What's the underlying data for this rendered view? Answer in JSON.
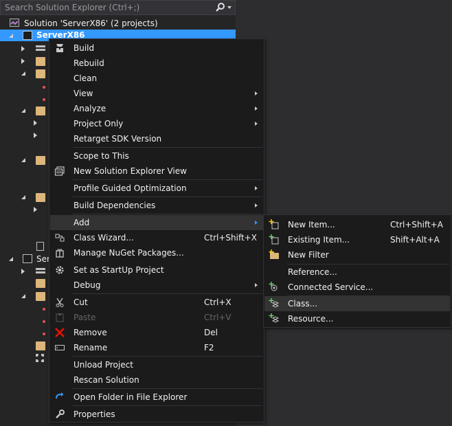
{
  "search": {
    "placeholder": "Search Solution Explorer (Ctrl+;)"
  },
  "tree": {
    "solution_label": "Solution 'ServerX86' (2 projects)",
    "project1_label": "ServerX86",
    "project2_label": "Ser"
  },
  "context_menu": {
    "build": "Build",
    "rebuild": "Rebuild",
    "clean": "Clean",
    "view": "View",
    "analyze": "Analyze",
    "project_only": "Project Only",
    "retarget": "Retarget SDK Version",
    "scope": "Scope to This",
    "new_view": "New Solution Explorer View",
    "pgo": "Profile Guided Optimization",
    "build_deps": "Build Dependencies",
    "add": "Add",
    "class_wizard": "Class Wizard...",
    "class_wizard_shortcut": "Ctrl+Shift+X",
    "nuget": "Manage NuGet Packages...",
    "startup": "Set as StartUp Project",
    "debug": "Debug",
    "cut": "Cut",
    "cut_shortcut": "Ctrl+X",
    "paste": "Paste",
    "paste_shortcut": "Ctrl+V",
    "remove": "Remove",
    "remove_shortcut": "Del",
    "rename": "Rename",
    "rename_shortcut": "F2",
    "unload": "Unload Project",
    "rescan": "Rescan Solution",
    "open_folder": "Open Folder in File Explorer",
    "properties": "Properties"
  },
  "add_submenu": {
    "new_item": "New Item...",
    "new_item_shortcut": "Ctrl+Shift+A",
    "existing_item": "Existing Item...",
    "existing_item_shortcut": "Shift+Alt+A",
    "new_filter": "New Filter",
    "reference": "Reference...",
    "connected_service": "Connected Service...",
    "class": "Class...",
    "resource": "Resource..."
  },
  "colors": {
    "selection": "#3399ff",
    "menu_bg": "#1b1b1c",
    "highlight": "#333334",
    "folder": "#dcb67a"
  }
}
